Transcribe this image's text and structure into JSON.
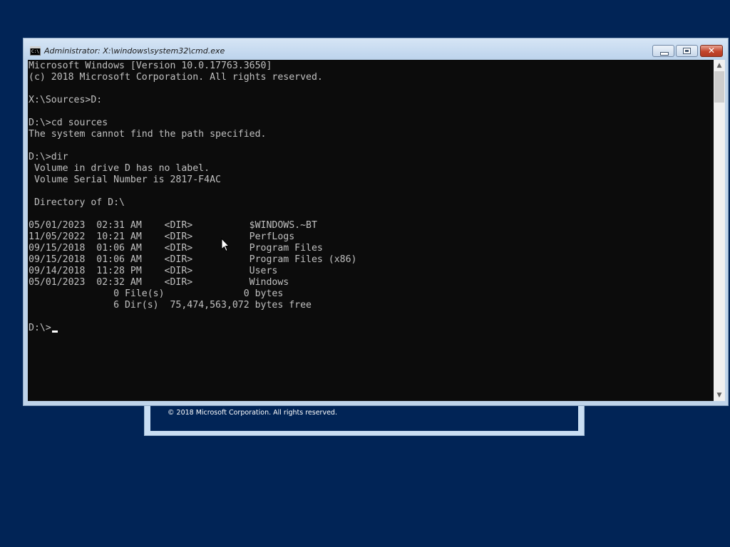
{
  "window": {
    "title": "Administrator: X:\\windows\\system32\\cmd.exe",
    "icon_label": "C:\\",
    "close_glyph": "✕"
  },
  "background_dialog": {
    "copyright": "© 2018 Microsoft Corporation. All rights reserved."
  },
  "console": {
    "lines": [
      "Microsoft Windows [Version 10.0.17763.3650]",
      "(c) 2018 Microsoft Corporation. All rights reserved.",
      "",
      "X:\\Sources>D:",
      "",
      "D:\\>cd sources",
      "The system cannot find the path specified.",
      "",
      "D:\\>dir",
      " Volume in drive D has no label.",
      " Volume Serial Number is 2817-F4AC",
      "",
      " Directory of D:\\",
      "",
      "05/01/2023  02:31 AM    <DIR>          $WINDOWS.~BT",
      "11/05/2022  10:21 AM    <DIR>          PerfLogs",
      "09/15/2018  01:06 AM    <DIR>          Program Files",
      "09/15/2018  01:06 AM    <DIR>          Program Files (x86)",
      "09/14/2018  11:28 PM    <DIR>          Users",
      "05/01/2023  02:32 AM    <DIR>          Windows",
      "               0 File(s)              0 bytes",
      "               6 Dir(s)  75,474,563,072 bytes free",
      "",
      "D:\\>"
    ]
  },
  "scrollbar": {
    "up_arrow": "▲",
    "down_arrow": "▼"
  },
  "colors": {
    "desktop_background": "#012456",
    "console_background": "#0c0c0c",
    "console_text": "#c0c0c0",
    "titlebar": "#bfd4ea",
    "close_button": "#c2452c"
  }
}
